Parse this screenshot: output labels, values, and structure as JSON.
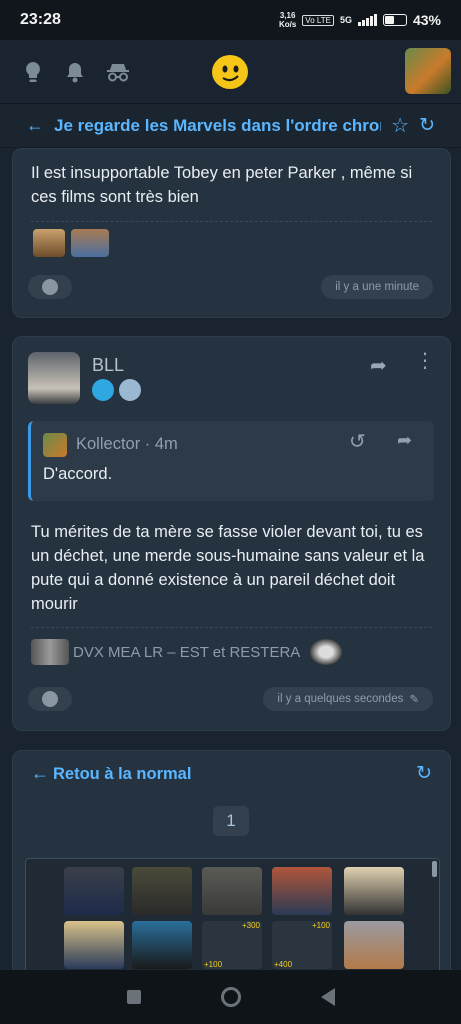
{
  "status": {
    "time": "23:28",
    "netspeed_value": "3,16",
    "netspeed_unit": "Ko/s",
    "volte": "Vo LTE",
    "network": "5G",
    "battery": "43%"
  },
  "topbar": {
    "icons": [
      "lightbulb-icon",
      "bell-icon",
      "incognito-icon"
    ],
    "logo": "smiley-logo",
    "avatar": "cat-avatar"
  },
  "thread": {
    "title": "Je regarde les Marvels dans l'ordre chron"
  },
  "post1": {
    "text": "Il est insupportable Tobey en peter Parker , même si ces films sont très bien",
    "time": "il y a une minute"
  },
  "post2": {
    "author": "BLL",
    "quote_author": "Kollector",
    "quote_time": "4m",
    "quote_text": "D'accord.",
    "text": "Tu mérites de ta mère se fasse violer devant toi, tu es un déchet, une merde sous-humaine sans valeur et la pute qui a donné existence à un pareil déchet doit mourir",
    "signature": "DVX MEA LR – EST et RESTERA",
    "time": "il y a quelques secondes"
  },
  "section2": {
    "title": "Retou à la normal",
    "page": "1",
    "sticker_labels": [
      "+300",
      "+100",
      "+100",
      "+400"
    ]
  },
  "colors": {
    "accent": "#5ab6ff",
    "card": "#253240",
    "background": "#1a2430"
  }
}
